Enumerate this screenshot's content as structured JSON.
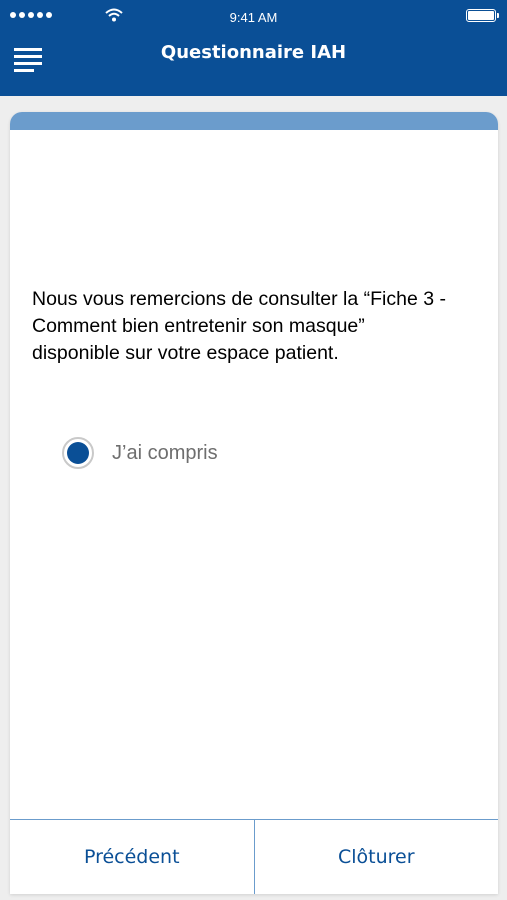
{
  "status_bar": {
    "time": "9:41 AM",
    "signal_icon": "signal-dots-icon",
    "wifi_icon": "wifi-icon",
    "battery_icon": "battery-icon",
    "battery_level": 1.0
  },
  "header": {
    "menu_icon": "hamburger-menu-icon",
    "title": "Questionnaire IAH"
  },
  "question": {
    "text": "Nous vous remercions de consulter la “Fiche 3 - Comment bien entretenir son masque” disponible sur votre espace patient."
  },
  "options": [
    {
      "label": "J’ai compris",
      "selected": true
    }
  ],
  "footer": {
    "previous_label": "Précédent",
    "close_label": "Clôturer"
  },
  "colors": {
    "primary": "#0a4f96",
    "accent": "#6b9ccc",
    "background": "#eeeeee",
    "card": "#ffffff",
    "option_text": "#6e6e6e"
  }
}
